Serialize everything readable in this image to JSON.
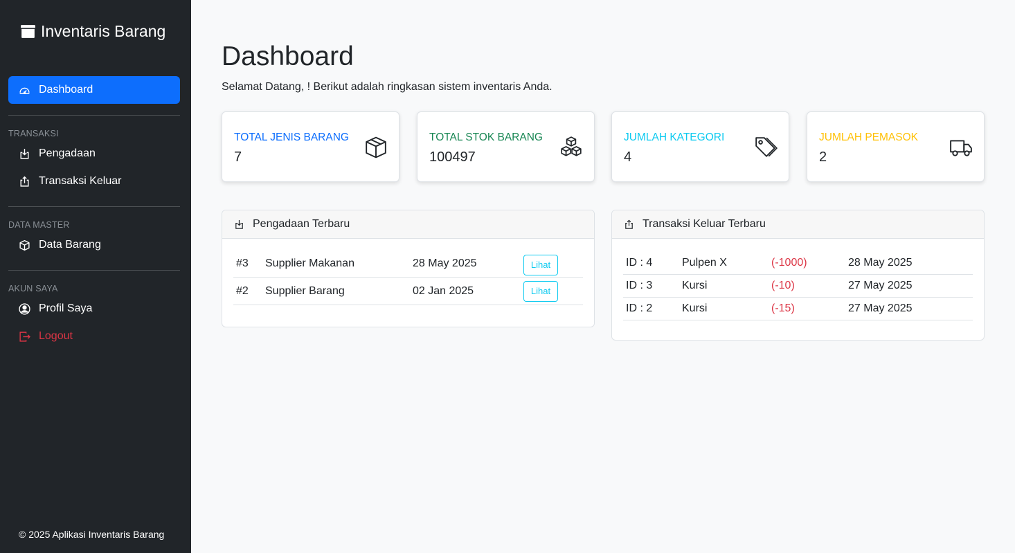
{
  "sidebar": {
    "brand": "Inventaris Barang",
    "items": {
      "dashboard": "Dashboard",
      "pengadaan": "Pengadaan",
      "transaksi_keluar": "Transaksi Keluar",
      "data_barang": "Data Barang",
      "profil": "Profil Saya",
      "logout": "Logout"
    },
    "sections": {
      "transaksi": "TRANSAKSI",
      "data_master": "DATA MASTER",
      "akun_saya": "AKUN SAYA"
    },
    "footer": "© 2025 Aplikasi Inventaris Barang"
  },
  "main": {
    "title": "Dashboard",
    "subtitle": "Selamat Datang, ! Berikut adalah ringkasan sistem inventaris Anda."
  },
  "stats": [
    {
      "label": "TOTAL JENIS BARANG",
      "value": "7",
      "color": "#0d6efd",
      "icon": "box-icon"
    },
    {
      "label": "TOTAL STOK BARANG",
      "value": "100497",
      "color": "#198754",
      "icon": "boxes-icon"
    },
    {
      "label": "JUMLAH KATEGORI",
      "value": "4",
      "color": "#0dcaf0",
      "icon": "tags-icon"
    },
    {
      "label": "JUMLAH PEMASOK",
      "value": "2",
      "color": "#ffc107",
      "icon": "truck-icon"
    }
  ],
  "pengadaan": {
    "title": "Pengadaan Terbaru",
    "rows": [
      {
        "id": "#3",
        "supplier": "Supplier Makanan",
        "date": "28 May 2025",
        "action": "Lihat"
      },
      {
        "id": "#2",
        "supplier": "Supplier Barang",
        "date": "02 Jan 2025",
        "action": "Lihat"
      }
    ]
  },
  "transaksi": {
    "title": "Transaksi Keluar Terbaru",
    "rows": [
      {
        "id": "ID : 4",
        "item": "Pulpen X",
        "qty": "(-1000)",
        "date": "28 May 2025"
      },
      {
        "id": "ID : 3",
        "item": "Kursi",
        "qty": "(-10)",
        "date": "27 May 2025"
      },
      {
        "id": "ID : 2",
        "item": "Kursi",
        "qty": "(-15)",
        "date": "27 May 2025"
      }
    ]
  }
}
